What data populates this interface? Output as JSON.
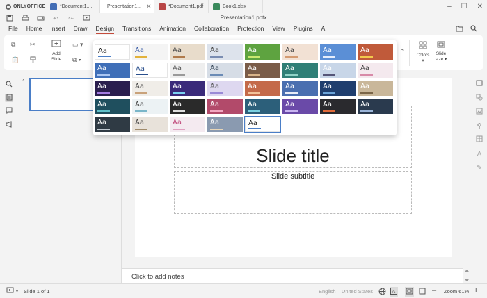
{
  "app": {
    "brand": "ONLYOFFICE",
    "tabs": [
      {
        "label": "*Document1....",
        "icon": "docx-icon",
        "color": "#446eb5",
        "active": false,
        "closable": false
      },
      {
        "label": "Presentation1...",
        "icon": "pptx-icon",
        "color": "#c44b3b",
        "active": true,
        "closable": true
      },
      {
        "label": "*Document1.pdf",
        "icon": "pdf-icon",
        "color": "#b84545",
        "active": false,
        "closable": false
      },
      {
        "label": "Book1.xlsx",
        "icon": "xlsx-icon",
        "color": "#3a8a5c",
        "active": false,
        "closable": false
      }
    ]
  },
  "document": {
    "title": "Presentation1.pptx"
  },
  "ribbon": {
    "tabs": [
      "File",
      "Home",
      "Insert",
      "Draw",
      "Design",
      "Transitions",
      "Animation",
      "Collaboration",
      "Protection",
      "View",
      "Plugins",
      "AI"
    ],
    "active_tab": "Design"
  },
  "toolbar": {
    "add_slide_label": "Add",
    "add_slide_label2": "Slide",
    "colors_label": "Colors",
    "slide_size_label": "Slide",
    "slide_size_label2": "size"
  },
  "gallery": {
    "sample_text": "Aa",
    "themes": [
      {
        "bg": "#ffffff",
        "fg": "#222",
        "bar": "#4a7ec7"
      },
      {
        "bg": "#f4f4f4",
        "fg": "#3a5da8",
        "bar": "#e2b23c"
      },
      {
        "bg": "#e8dccb",
        "fg": "#444",
        "bar": "#b07a4a"
      },
      {
        "bg": "#dde3ec",
        "fg": "#444",
        "bar": "#7a8db2"
      },
      {
        "bg": "#5ea340",
        "fg": "#fff",
        "bar": "#c9e86f"
      },
      {
        "bg": "#f2e1d4",
        "fg": "#444",
        "bar": "#d49b72"
      },
      {
        "bg": "#5b8fd6",
        "fg": "#fff",
        "bar": "#e6eefc"
      },
      {
        "bg": "#c05a3a",
        "fg": "#fff",
        "bar": "#f2c94c"
      },
      {
        "bg": "#3f6fb8",
        "fg": "#fff",
        "bar": "#aac6f2"
      },
      {
        "bg": "#ffffff",
        "fg": "#2a4f8c",
        "bar": "#2a4f8c"
      },
      {
        "bg": "#eeeeee",
        "fg": "#555",
        "bar": "#999"
      },
      {
        "bg": "#d6dde6",
        "fg": "#345",
        "bar": "#6b8bb5"
      },
      {
        "bg": "#7a5c48",
        "fg": "#fff",
        "bar": "#d9b48a"
      },
      {
        "bg": "#2f7f77",
        "fg": "#fff",
        "bar": "#8fd3c7"
      },
      {
        "bg": "#c8d6e8",
        "fg": "#fff",
        "bar": "#557"
      },
      {
        "bg": "#f4e9ee",
        "fg": "#444",
        "bar": "#d88aa8"
      },
      {
        "bg": "#2a1e4e",
        "fg": "#fff",
        "bar": "#a37be0"
      },
      {
        "bg": "#f0ede8",
        "fg": "#444",
        "bar": "#c9a27a"
      },
      {
        "bg": "#3a2a7a",
        "fg": "#fff",
        "bar": "#7ad0f0"
      },
      {
        "bg": "#ded8f0",
        "fg": "#555",
        "bar": "#9a8ad6"
      },
      {
        "bg": "#c46a4a",
        "fg": "#fff",
        "bar": "#f3c29a"
      },
      {
        "bg": "#4a6fb0",
        "fg": "#fff",
        "bar": "#e8ecf6"
      },
      {
        "bg": "#1f3e6e",
        "fg": "#fff",
        "bar": "#6aa3d8"
      },
      {
        "bg": "#c9b79a",
        "fg": "#fff",
        "bar": "#7a6548"
      },
      {
        "bg": "#1f4f5e",
        "fg": "#fff",
        "bar": "#5fc0c9"
      },
      {
        "bg": "#ecf2f4",
        "fg": "#444",
        "bar": "#7ab6c9"
      },
      {
        "bg": "#2a2a2a",
        "fg": "#fff",
        "bar": "#ddd"
      },
      {
        "bg": "#b24a6a",
        "fg": "#fff",
        "bar": "#f2a6c0"
      },
      {
        "bg": "#2c5f7a",
        "fg": "#fff",
        "bar": "#7ad0e0"
      },
      {
        "bg": "#6a4aa8",
        "fg": "#fff",
        "bar": "#c8b4f0"
      },
      {
        "bg": "#2a2a2e",
        "fg": "#fff",
        "bar": "#e06a3a"
      },
      {
        "bg": "#2a3a4e",
        "fg": "#fff",
        "bar": "#9ab4d8"
      },
      {
        "bg": "#2f3a44",
        "fg": "#fff",
        "bar": "#c0c8d0"
      },
      {
        "bg": "#e8e2da",
        "fg": "#444",
        "bar": "#a08a6a"
      },
      {
        "bg": "#f4eaf0",
        "fg": "#c0487a",
        "bar": "#e0a0c0"
      },
      {
        "bg": "#8a9ab0",
        "fg": "#fff",
        "bar": "#e8d6b8"
      },
      {
        "bg": "#ffffff",
        "fg": "#222",
        "bar": "#4a7ec7"
      }
    ]
  },
  "thumbnails": {
    "number": "1"
  },
  "slide": {
    "title": "Slide title",
    "subtitle": "Slide subtitle"
  },
  "notes": {
    "placeholder": "Click to add notes"
  },
  "status": {
    "slide_counter": "Slide 1 of 1",
    "language": "English – United States",
    "zoom": "Zoom 61%"
  }
}
